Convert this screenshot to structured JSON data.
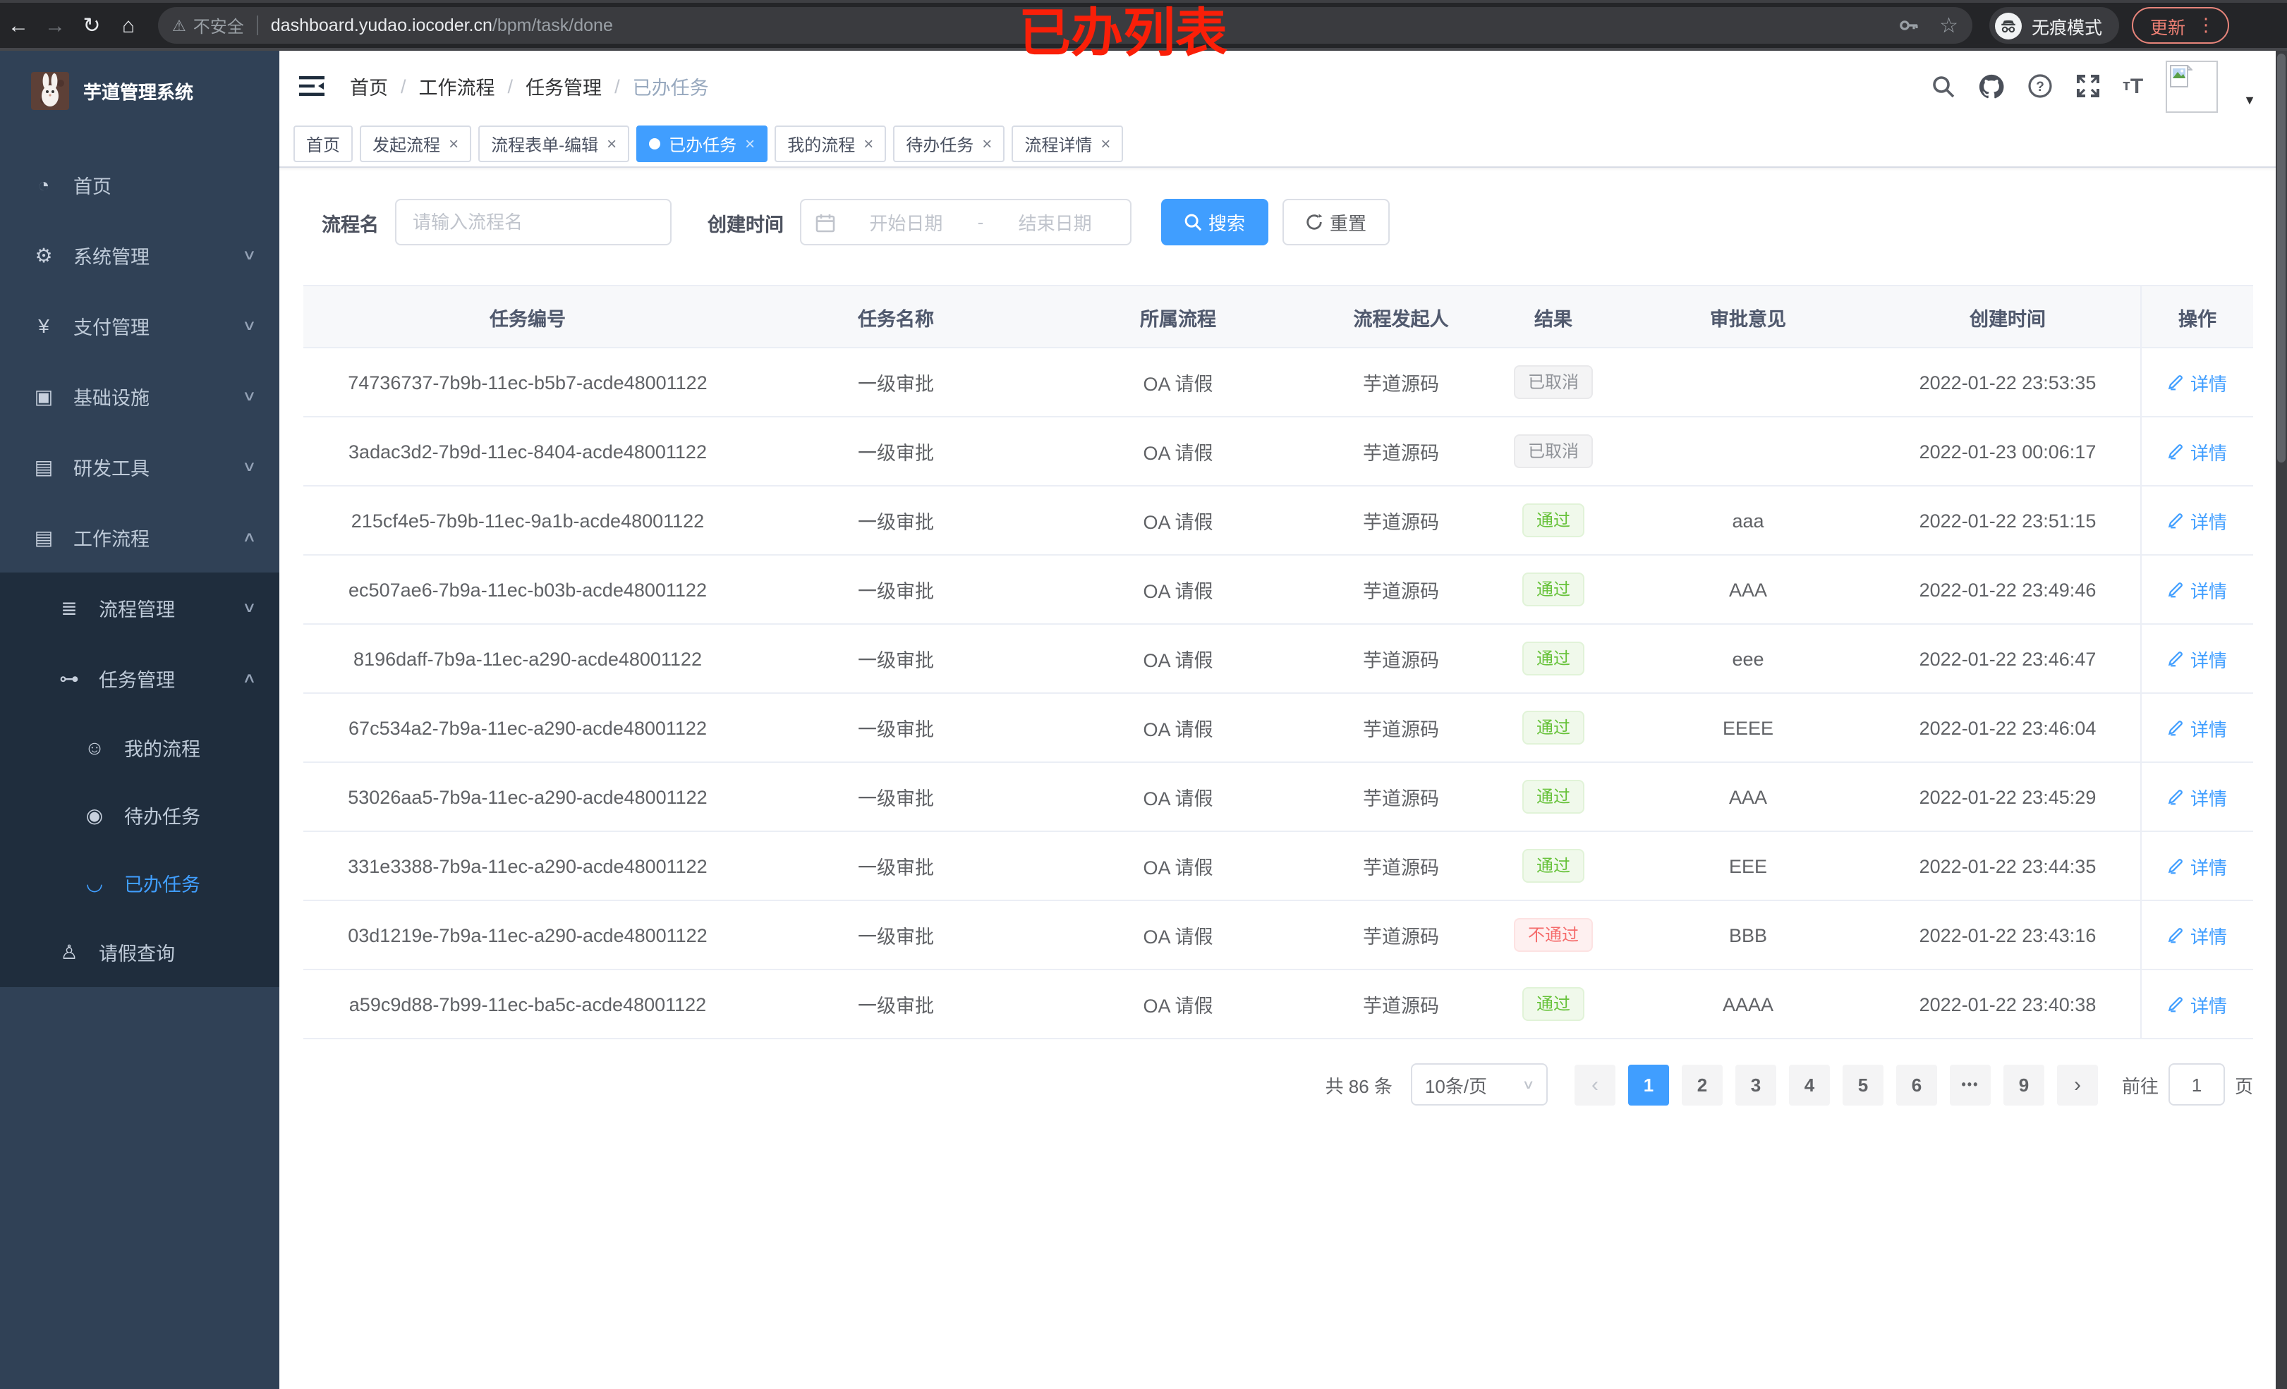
{
  "colors": {
    "accent": "#409eff",
    "success": "#67c23a",
    "danger": "#f56c6c",
    "info": "#909399",
    "annotation_red": "#fa1f08",
    "update_salmon": "#ee8074",
    "sidebar_bg": "#304156",
    "submenu_bg": "#1f2d3d"
  },
  "annotation": "已办列表",
  "browser": {
    "security_label": "不安全",
    "url_host": "dashboard.yudao.iocoder.cn",
    "url_path": "/bpm/task/done",
    "incognito_label": "无痕模式",
    "update_label": "更新",
    "kebab_glyph": "⋮",
    "back_glyph": "←",
    "forward_glyph": "→",
    "reload_glyph": "↻",
    "home_glyph": "⌂",
    "warning_glyph": "⚠",
    "star_glyph": "☆"
  },
  "sidebar": {
    "app_title": "芋道管理系统",
    "items": [
      {
        "label": "首页",
        "icon": "dashboard-icon",
        "glyph": "◔",
        "level": "1",
        "sub": "false",
        "active": "false",
        "arrow": ""
      },
      {
        "label": "系统管理",
        "icon": "gear-icon",
        "glyph": "⚙",
        "level": "1",
        "sub": "false",
        "active": "false",
        "arrow": "∨"
      },
      {
        "label": "支付管理",
        "icon": "yen-icon",
        "glyph": "¥",
        "level": "1",
        "sub": "false",
        "active": "false",
        "arrow": "∨"
      },
      {
        "label": "基础设施",
        "icon": "infrastructure-icon",
        "glyph": "▣",
        "level": "1",
        "sub": "false",
        "active": "false",
        "arrow": "∨"
      },
      {
        "label": "研发工具",
        "icon": "toolbox-icon",
        "glyph": "▤",
        "level": "1",
        "sub": "false",
        "active": "false",
        "arrow": "∨"
      },
      {
        "label": "工作流程",
        "icon": "workflow-icon",
        "glyph": "▤",
        "level": "1",
        "sub": "false",
        "active": "false",
        "arrow": "∧"
      },
      {
        "label": "流程管理",
        "icon": "process-mgmt-icon",
        "glyph": "≣",
        "level": "2",
        "sub": "true",
        "active": "false",
        "arrow": "∨"
      },
      {
        "label": "任务管理",
        "icon": "task-mgmt-icon",
        "glyph": "⊶",
        "level": "2",
        "sub": "true",
        "active": "false",
        "arrow": "∧"
      },
      {
        "label": "我的流程",
        "icon": "my-process-icon",
        "glyph": "☺",
        "level": "3",
        "sub": "true",
        "active": "false",
        "arrow": ""
      },
      {
        "label": "待办任务",
        "icon": "todo-task-icon",
        "glyph": "◉",
        "level": "3",
        "sub": "true",
        "active": "false",
        "arrow": ""
      },
      {
        "label": "已办任务",
        "icon": "done-task-icon",
        "glyph": "◡",
        "level": "3",
        "sub": "true",
        "active": "true",
        "arrow": ""
      },
      {
        "label": "请假查询",
        "icon": "leave-query-icon",
        "glyph": "♙",
        "level": "2",
        "sub": "true",
        "active": "false",
        "arrow": ""
      }
    ]
  },
  "navbar": {
    "breadcrumb": [
      "首页",
      "工作流程",
      "任务管理",
      "已办任务"
    ],
    "icons": [
      "search-icon",
      "github-icon",
      "help-icon",
      "fullscreen-icon",
      "font-size-icon",
      "avatar",
      "caret-down-icon"
    ]
  },
  "tabs": [
    {
      "label": "首页",
      "closable": "false",
      "active": "false"
    },
    {
      "label": "发起流程",
      "closable": "true",
      "active": "false"
    },
    {
      "label": "流程表单-编辑",
      "closable": "true",
      "active": "false"
    },
    {
      "label": "已办任务",
      "closable": "true",
      "active": "true"
    },
    {
      "label": "我的流程",
      "closable": "true",
      "active": "false"
    },
    {
      "label": "待办任务",
      "closable": "true",
      "active": "false"
    },
    {
      "label": "流程详情",
      "closable": "true",
      "active": "false"
    }
  ],
  "filters": {
    "name_label": "流程名",
    "name_placeholder": "请输入流程名",
    "time_label": "创建时间",
    "start_placeholder": "开始日期",
    "range_separator": "-",
    "end_placeholder": "结束日期",
    "search_label": "搜索",
    "reset_label": "重置"
  },
  "table": {
    "columns": [
      "任务编号",
      "任务名称",
      "所属流程",
      "流程发起人",
      "结果",
      "审批意见",
      "创建时间",
      "操作"
    ],
    "detail_label": "详情",
    "rows": [
      {
        "id": "74736737-7b9b-11ec-b5b7-acde48001122",
        "name": "一级审批",
        "process": "OA 请假",
        "starter": "芋道源码",
        "result": "已取消",
        "result_type": "info",
        "opinion": "",
        "created": "2022-01-22 23:53:35"
      },
      {
        "id": "3adac3d2-7b9d-11ec-8404-acde48001122",
        "name": "一级审批",
        "process": "OA 请假",
        "starter": "芋道源码",
        "result": "已取消",
        "result_type": "info",
        "opinion": "",
        "created": "2022-01-23 00:06:17"
      },
      {
        "id": "215cf4e5-7b9b-11ec-9a1b-acde48001122",
        "name": "一级审批",
        "process": "OA 请假",
        "starter": "芋道源码",
        "result": "通过",
        "result_type": "success",
        "opinion": "aaa",
        "created": "2022-01-22 23:51:15"
      },
      {
        "id": "ec507ae6-7b9a-11ec-b03b-acde48001122",
        "name": "一级审批",
        "process": "OA 请假",
        "starter": "芋道源码",
        "result": "通过",
        "result_type": "success",
        "opinion": "AAA",
        "created": "2022-01-22 23:49:46"
      },
      {
        "id": "8196daff-7b9a-11ec-a290-acde48001122",
        "name": "一级审批",
        "process": "OA 请假",
        "starter": "芋道源码",
        "result": "通过",
        "result_type": "success",
        "opinion": "eee",
        "created": "2022-01-22 23:46:47"
      },
      {
        "id": "67c534a2-7b9a-11ec-a290-acde48001122",
        "name": "一级审批",
        "process": "OA 请假",
        "starter": "芋道源码",
        "result": "通过",
        "result_type": "success",
        "opinion": "EEEE",
        "created": "2022-01-22 23:46:04"
      },
      {
        "id": "53026aa5-7b9a-11ec-a290-acde48001122",
        "name": "一级审批",
        "process": "OA 请假",
        "starter": "芋道源码",
        "result": "通过",
        "result_type": "success",
        "opinion": "AAA",
        "created": "2022-01-22 23:45:29"
      },
      {
        "id": "331e3388-7b9a-11ec-a290-acde48001122",
        "name": "一级审批",
        "process": "OA 请假",
        "starter": "芋道源码",
        "result": "通过",
        "result_type": "success",
        "opinion": "EEE",
        "created": "2022-01-22 23:44:35"
      },
      {
        "id": "03d1219e-7b9a-11ec-a290-acde48001122",
        "name": "一级审批",
        "process": "OA 请假",
        "starter": "芋道源码",
        "result": "不通过",
        "result_type": "danger",
        "opinion": "BBB",
        "created": "2022-01-22 23:43:16"
      },
      {
        "id": "a59c9d88-7b99-11ec-ba5c-acde48001122",
        "name": "一级审批",
        "process": "OA 请假",
        "starter": "芋道源码",
        "result": "通过",
        "result_type": "success",
        "opinion": "AAAA",
        "created": "2022-01-22 23:40:38"
      }
    ]
  },
  "pagination": {
    "total_label": "共 86 条",
    "page_size_label": "10条/页",
    "prev_glyph": "‹",
    "next_glyph": "›",
    "pages": [
      {
        "label": "1",
        "state": "active"
      },
      {
        "label": "2",
        "state": "normal"
      },
      {
        "label": "3",
        "state": "normal"
      },
      {
        "label": "4",
        "state": "normal"
      },
      {
        "label": "5",
        "state": "normal"
      },
      {
        "label": "6",
        "state": "normal"
      },
      {
        "label": "•••",
        "state": "ellipsis"
      },
      {
        "label": "9",
        "state": "normal"
      }
    ],
    "goto_label": "前往",
    "goto_value": "1",
    "page_unit": "页"
  }
}
